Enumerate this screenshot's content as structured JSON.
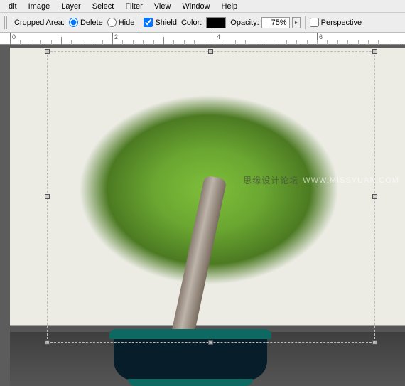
{
  "menu": {
    "items": [
      "dit",
      "Image",
      "Layer",
      "Select",
      "Filter",
      "View",
      "Window",
      "Help"
    ]
  },
  "options": {
    "cropped_area_label": "Cropped Area:",
    "radio_delete": "Delete",
    "radio_hide": "Hide",
    "shield_label": "Shield",
    "color_label": "Color:",
    "color_value": "#000000",
    "opacity_label": "Opacity:",
    "opacity_value": "75%",
    "perspective_label": "Perspective",
    "selected_radio": "delete",
    "shield_checked": true,
    "perspective_checked": false
  },
  "ruler": {
    "majors": [
      "0",
      "2",
      "4",
      "6"
    ]
  },
  "watermark": {
    "cn": "思缘设计论坛",
    "url": "WWW.MISSYUAN.COM"
  }
}
